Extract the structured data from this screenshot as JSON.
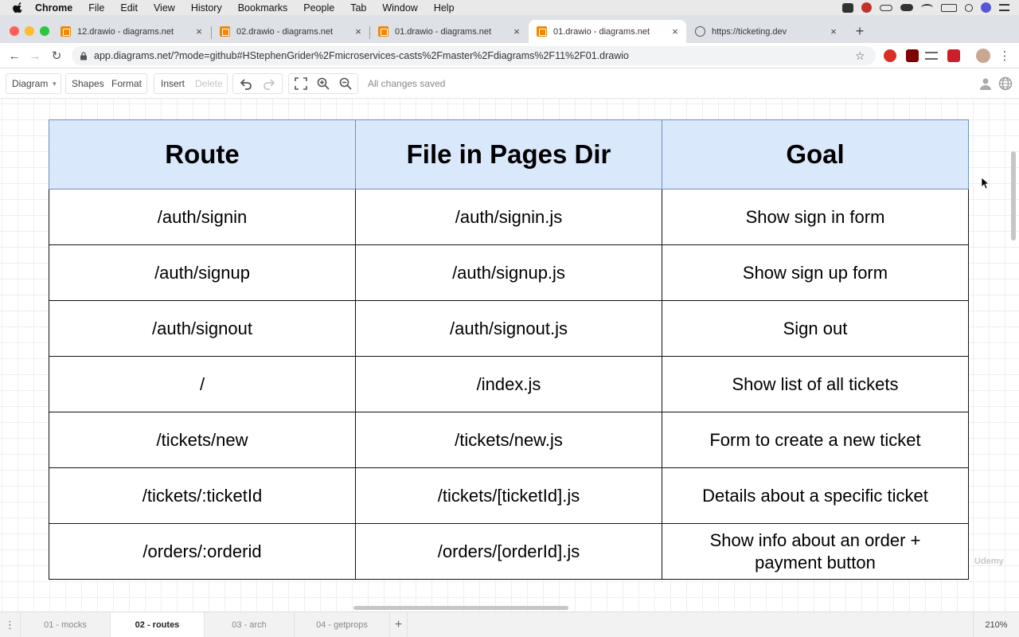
{
  "menubar": {
    "app": "Chrome",
    "items": [
      "File",
      "Edit",
      "View",
      "History",
      "Bookmarks",
      "People",
      "Tab",
      "Window",
      "Help"
    ]
  },
  "tabs": [
    {
      "title": "12.drawio - diagrams.net",
      "active": false,
      "icon": "drawio-icon"
    },
    {
      "title": "02.drawio - diagrams.net",
      "active": false,
      "icon": "drawio-icon"
    },
    {
      "title": "01.drawio - diagrams.net",
      "active": false,
      "icon": "drawio-icon"
    },
    {
      "title": "01.drawio - diagrams.net",
      "active": true,
      "icon": "drawio-icon"
    },
    {
      "title": "https://ticketing.dev",
      "active": false,
      "icon": "globe-icon"
    }
  ],
  "address": {
    "url": "app.diagrams.net/?mode=github#HStephenGrider%2Fmicroservices-casts%2Fmaster%2Fdiagrams%2F11%2F01.drawio"
  },
  "toolbar": {
    "diagram": "Diagram",
    "shapes": "Shapes",
    "format": "Format",
    "insert": "Insert",
    "delete": "Delete",
    "status": "All changes saved"
  },
  "table": {
    "headers": [
      "Route",
      "File in Pages Dir",
      "Goal"
    ],
    "rows": [
      [
        "/auth/signin",
        "/auth/signin.js",
        "Show sign in form"
      ],
      [
        "/auth/signup",
        "/auth/signup.js",
        "Show sign up form"
      ],
      [
        "/auth/signout",
        "/auth/signout.js",
        "Sign out"
      ],
      [
        "/",
        "/index.js",
        "Show list of all tickets"
      ],
      [
        "/tickets/new",
        "/tickets/new.js",
        "Form to create a new ticket"
      ],
      [
        "/tickets/:ticketId",
        "/tickets/[ticketId].js",
        "Details about a specific ticket"
      ],
      [
        "/orders/:orderid",
        "/orders/[orderId].js",
        "Show info about an order + payment button"
      ]
    ]
  },
  "pages": [
    {
      "label": "01 - mocks",
      "active": false
    },
    {
      "label": "02 - routes",
      "active": true
    },
    {
      "label": "03 - arch",
      "active": false
    },
    {
      "label": "04 - getprops",
      "active": false
    }
  ],
  "zoom": "210%",
  "watermark": "Udemy",
  "colors": {
    "header_fill": "#dae8fc",
    "header_border": "#6c8ebf",
    "drawio_orange": "#f08705"
  }
}
